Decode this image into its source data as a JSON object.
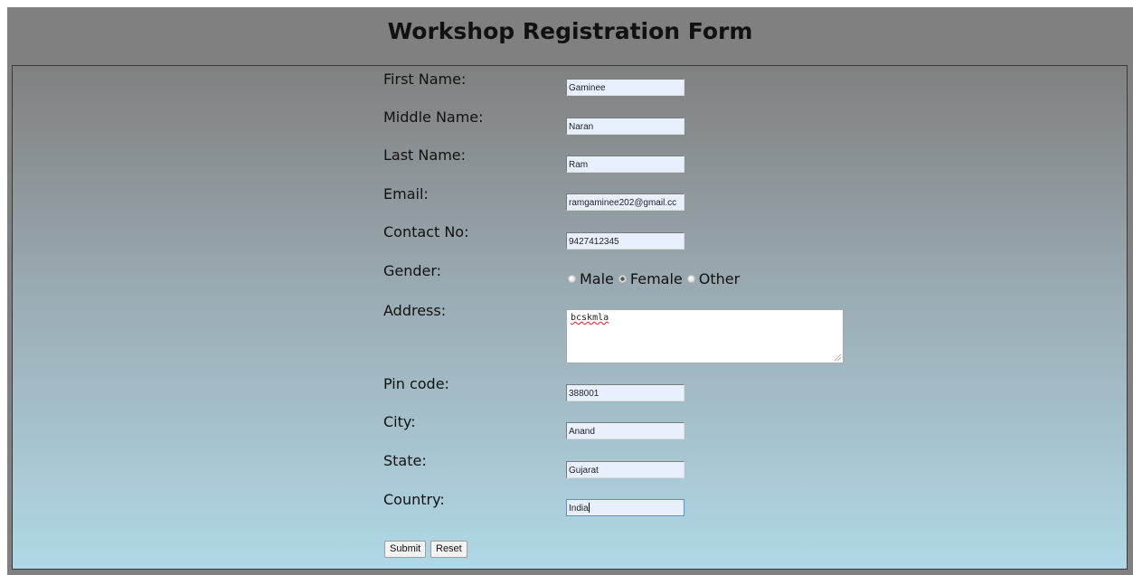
{
  "page": {
    "title": "Workshop Registration Form"
  },
  "form": {
    "first_name": {
      "label": "First Name:",
      "value": "Gaminee"
    },
    "middle_name": {
      "label": "Middle Name:",
      "value": "Naran"
    },
    "last_name": {
      "label": "Last Name:",
      "value": "Ram"
    },
    "email": {
      "label": "Email:",
      "value": "ramgaminee202@gmail.cc"
    },
    "contact": {
      "label": "Contact No:",
      "value": "9427412345"
    },
    "gender": {
      "label": "Gender:",
      "options": [
        "Male",
        "Female",
        "Other"
      ],
      "selected": "Female"
    },
    "address": {
      "label": "Address:",
      "value": "bcskmla"
    },
    "pin": {
      "label": "Pin code:",
      "value": "388001"
    },
    "city": {
      "label": "City:",
      "value": "Anand"
    },
    "state": {
      "label": "State:",
      "value": "Gujarat"
    },
    "country": {
      "label": "Country:",
      "value": "India"
    },
    "submit_label": "Submit",
    "reset_label": "Reset"
  },
  "colors": {
    "header_bg": "#808080",
    "gradient_top": "#808080",
    "gradient_bottom": "#b0d8e6",
    "input_bg": "#e8f0fe"
  }
}
